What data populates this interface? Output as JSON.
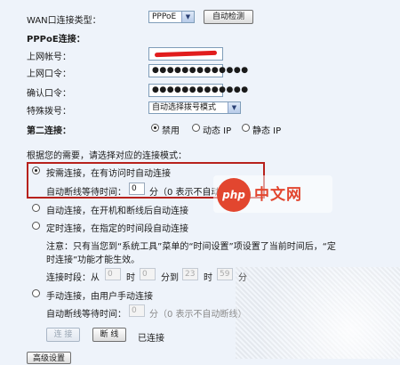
{
  "wan": {
    "type_label": "WAN口连接类型：",
    "type_value": "PPPoE",
    "auto_detect": "自动检测"
  },
  "pppoe": {
    "section_title": "PPPoE连接：",
    "account_label": "上网帐号：",
    "password_label": "上网口令：",
    "password_mask": "●●●●●●●●●●●●●",
    "confirm_label": "确认口令：",
    "confirm_mask": "●●●●●●●●●●●●●",
    "special_dial_label": "特殊拨号：",
    "special_dial_value": "自动选择拨号模式"
  },
  "second_conn": {
    "label": "第二连接：",
    "options": [
      "禁用",
      "动态 IP",
      "静态 IP"
    ],
    "selected": "禁用"
  },
  "mode": {
    "intro": "根据您的需要，请选择对应的连接模式：",
    "on_demand": {
      "label": "按需连接，在有访问时自动连接",
      "idle_prefix": "自动断线等待时间：",
      "idle_value": "0",
      "idle_suffix": "分（0 表示不自动断线）"
    },
    "auto": {
      "label": "自动连接，在开机和断线后自动连接"
    },
    "timed": {
      "label": "定时连接，在指定的时间段自动连接",
      "note_line1": "注意：只有当您到“系统工具”菜单的“时间设置”项设置了当前时间后，“定",
      "note_line2": "时连接”功能才能生效。",
      "period_label": "连接时段：从",
      "from_hour": "0",
      "hour1": "时",
      "from_min": "0",
      "min_to": "分到",
      "to_hour": "23",
      "hour2": "时",
      "to_min": "59",
      "min_end": "分"
    },
    "manual": {
      "label": "手动连接，由用户手动连接",
      "idle_prefix": "自动断线等待时间：",
      "idle_value": "0",
      "idle_suffix": "分（0 表示不自动断线）"
    }
  },
  "actions": {
    "connect": "连 接",
    "disconnect": "断 线",
    "status": "已连接",
    "advanced": "高级设置"
  },
  "watermark": {
    "logo": "php",
    "text": "中文网"
  },
  "colors": {
    "highlight": "#b7211c",
    "redact": "#e11d1d",
    "background": "#eef3fa"
  }
}
